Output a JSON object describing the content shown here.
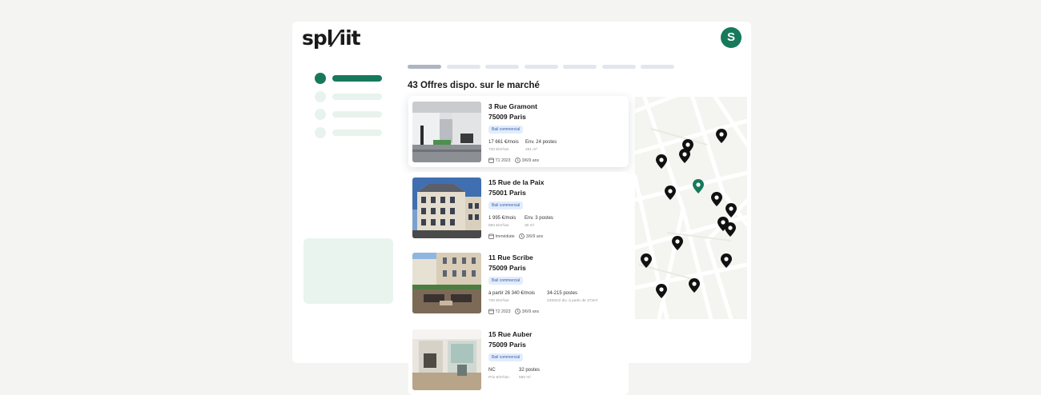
{
  "brand": {
    "logo_text_a": "spl",
    "logo_text_b": "iit"
  },
  "user": {
    "avatar_initial": "S",
    "avatar_color": "#17795b"
  },
  "colors": {
    "accent": "#17795b",
    "accent_light": "#e9f3ee",
    "badge_bg": "#e2ecfb",
    "badge_text": "#3a5fb0"
  },
  "main": {
    "heading": "43 Offres dispo. sur le marché"
  },
  "listings": [
    {
      "line1": "3 Rue Gramont",
      "line2": "75009 Paris",
      "badge": "Bail commercial",
      "price": "17 661 €/mois",
      "price_sub": "720 €/m²/an",
      "posts": "Env. 24 postes",
      "area": "261 m²",
      "date": "T1 2023",
      "duration": "3/6/9 ans"
    },
    {
      "line1": "15 Rue de la Paix",
      "line2": "75001 Paris",
      "badge": "Bail commercial",
      "price": "1 995 €/mois",
      "price_sub": "850 €/m²/an",
      "posts": "Env. 3 postes",
      "area": "30 m²",
      "date": "Immédiate",
      "duration": "3/6/9 ans"
    },
    {
      "line1": "11 Rue Scribe",
      "line2": "75009 Paris",
      "badge": "Bail commercial",
      "price": "à partir 26 340 €/mois",
      "price_sub": "720 €/m²/an",
      "posts": "34-215 postes",
      "area": "2283m2 div. à partir de 372m²",
      "date": "T2 2023",
      "duration": "3/6/9 ans"
    },
    {
      "line1": "15 Rue Auber",
      "line2": "75009 Paris",
      "badge": "Bail commercial",
      "price": "NC",
      "price_sub": "Prix €/m²/an",
      "posts": "32 postes",
      "area": "580 m²"
    }
  ],
  "icons": {
    "date": "calendar-icon",
    "duration": "clock-icon",
    "map_marker": "map-pin-icon"
  }
}
